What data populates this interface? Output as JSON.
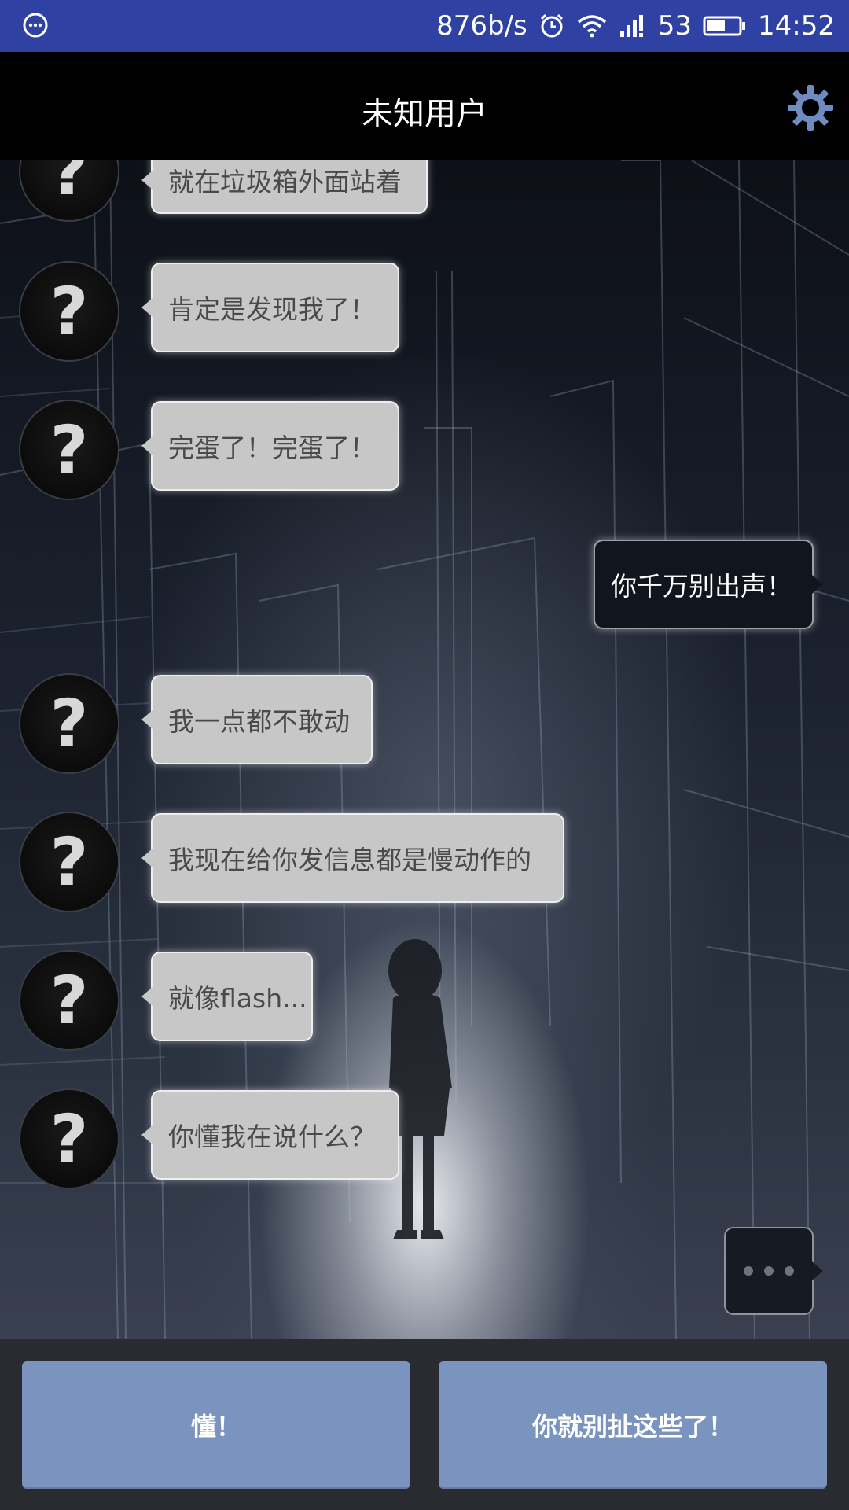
{
  "status_bar": {
    "network_speed": "876b/s",
    "signal_text": "53",
    "time": "14:52",
    "icons": [
      "chat-bubble-icon",
      "alarm-icon",
      "wifi-icon",
      "signal-icon",
      "battery-icon"
    ]
  },
  "header": {
    "title": "未知用户",
    "settings_icon": "gear-icon"
  },
  "avatar_glyph": "?",
  "messages": [
    {
      "side": "left",
      "text": "就在垃圾箱外面站着"
    },
    {
      "side": "left",
      "text": "肯定是发现我了！"
    },
    {
      "side": "left",
      "text": "完蛋了！完蛋了！"
    },
    {
      "side": "right",
      "text": "你千万别出声！"
    },
    {
      "side": "left",
      "text": "我一点都不敢动"
    },
    {
      "side": "left",
      "text": "我现在给你发信息都是慢动作的"
    },
    {
      "side": "left",
      "text": "就像flash..."
    },
    {
      "side": "left",
      "text": "你懂我在说什么？"
    }
  ],
  "typing_indicator": "three-dots-icon",
  "replies": [
    {
      "label": "懂！"
    },
    {
      "label": "你就别扯这些了！"
    }
  ],
  "colors": {
    "status_bar": "#2f42a3",
    "title_bar": "#000000",
    "reply_button": "#7b93bf",
    "left_bubble": "#c7c7c7",
    "right_bubble": "#11151d"
  }
}
